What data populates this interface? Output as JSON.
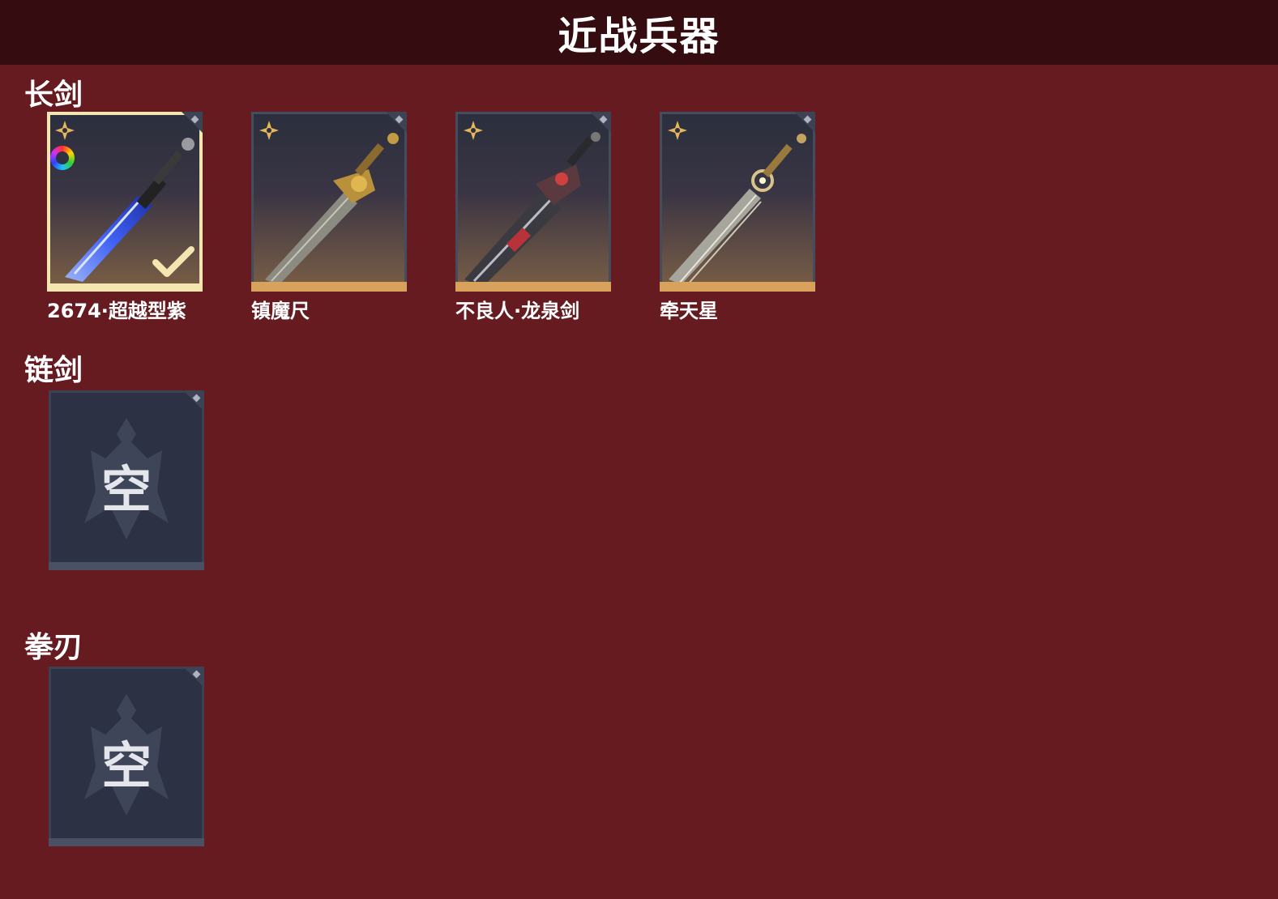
{
  "header": {
    "title": "近战兵器"
  },
  "sections": [
    {
      "label": "长剑",
      "items": [
        {
          "name": "2674·超越型紫",
          "selected": true,
          "glow_color": "#4a7bff"
        },
        {
          "name": "镇魔尺",
          "selected": false
        },
        {
          "name": "不良人·龙泉剑",
          "selected": false
        },
        {
          "name": "牵天星",
          "selected": false
        }
      ]
    },
    {
      "label": "链剑",
      "empty_text": "空"
    },
    {
      "label": "拳刃",
      "empty_text": "空"
    }
  ],
  "colors": {
    "background": "#661b20",
    "header_bar": "#350d10",
    "card_accent": "#d9a25c",
    "selected_border": "#f3e6b0",
    "empty_slot": "#2c3244"
  },
  "icons": [
    "star-badge-icon",
    "rainbow-ring-icon",
    "checkmark-icon",
    "corner-mark-icon"
  ]
}
